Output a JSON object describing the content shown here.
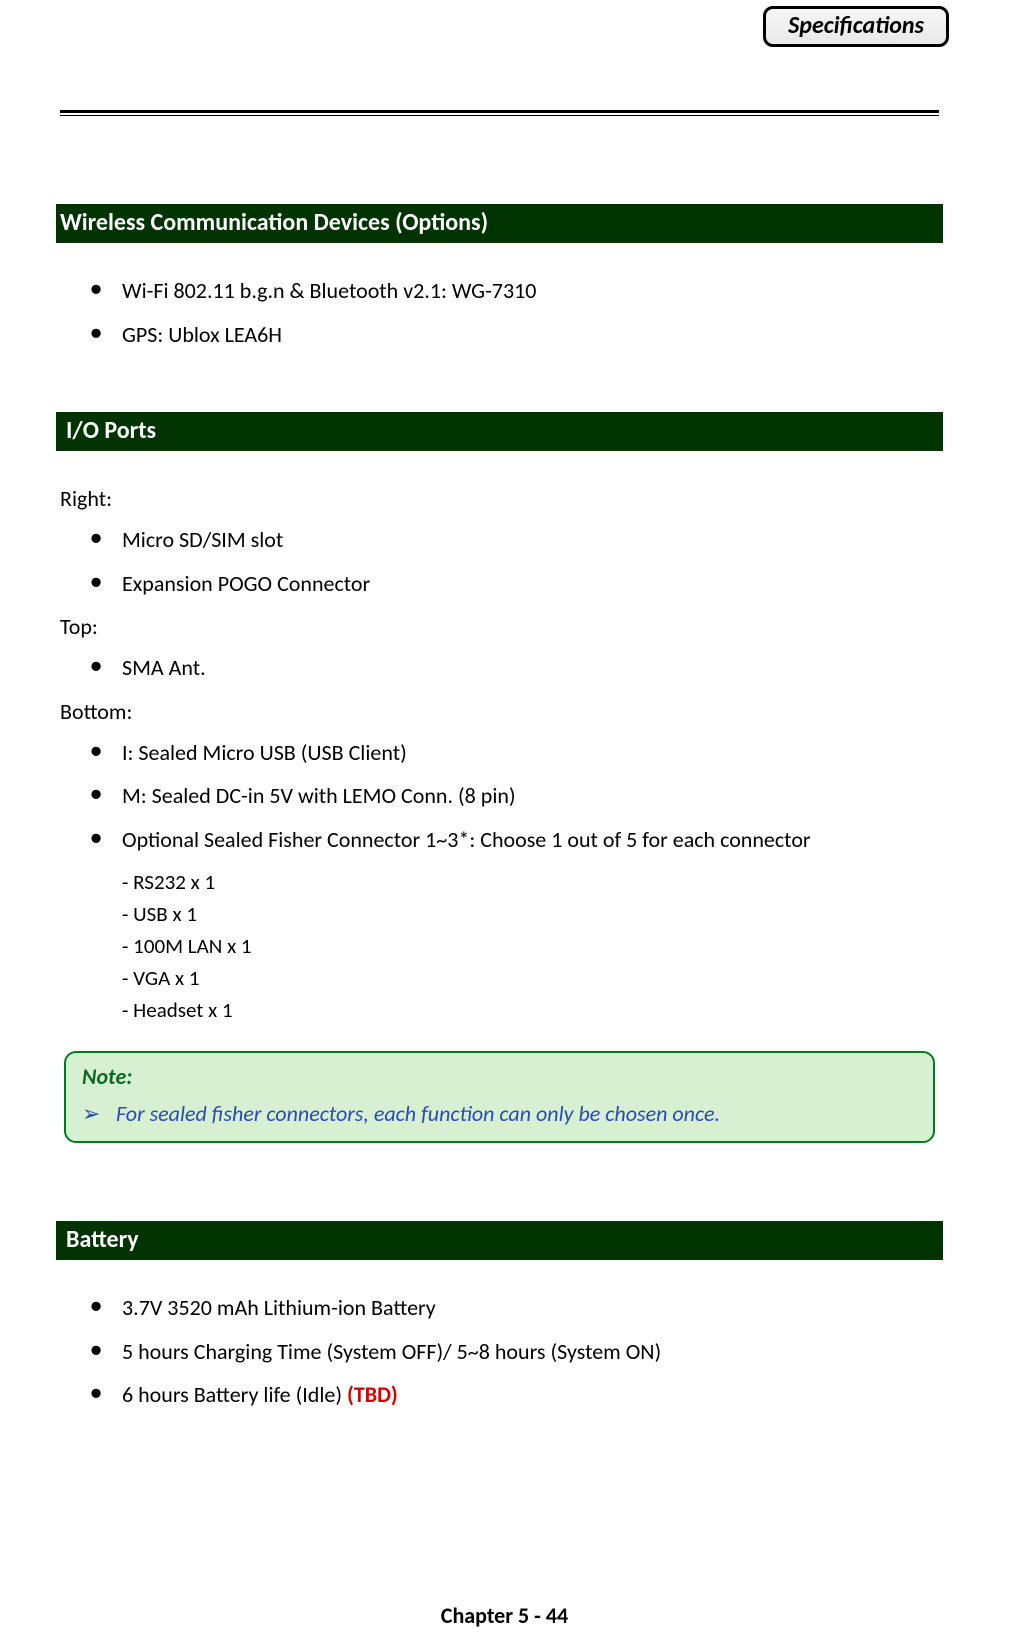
{
  "header": {
    "badge": "Specifications"
  },
  "sections": {
    "wireless": {
      "title": "Wireless Communication Devices (Options)",
      "items": [
        "Wi-Fi 802.11 b.g.n & Bluetooth v2.1: WG-7310",
        "GPS: Ublox LEA6H"
      ]
    },
    "io": {
      "title": "I/O Ports",
      "right_label": "Right:",
      "right_items": [
        "Micro SD/SIM slot",
        "Expansion POGO Connector"
      ],
      "top_label": "Top:",
      "top_items": [
        "SMA Ant."
      ],
      "bottom_label": "Bottom:",
      "bottom_items": [
        "I: Sealed Micro USB (USB Client)",
        "M: Sealed DC-in 5V with LEMO Conn. (8 pin)",
        "Optional Sealed Fisher Connector 1~3*: Choose 1 out of 5 for each connector"
      ],
      "fisher_options": [
        "- RS232 x 1",
        "- USB x 1",
        "- 100M LAN x 1",
        "- VGA x 1",
        "- Headset x 1"
      ]
    },
    "note": {
      "title": "Note:",
      "arrow": "➢",
      "text": "For sealed fisher connectors, each function can only be chosen once."
    },
    "battery": {
      "title": "Battery",
      "items": [
        "3.7V 3520 mAh Lithium-ion Battery",
        "5 hours Charging Time (System OFF)/ 5~8 hours (System ON)"
      ],
      "last_item_prefix": "6 hours Battery life (Idle) ",
      "last_item_tbd": "(TBD)"
    }
  },
  "footer": "Chapter 5 - 44"
}
